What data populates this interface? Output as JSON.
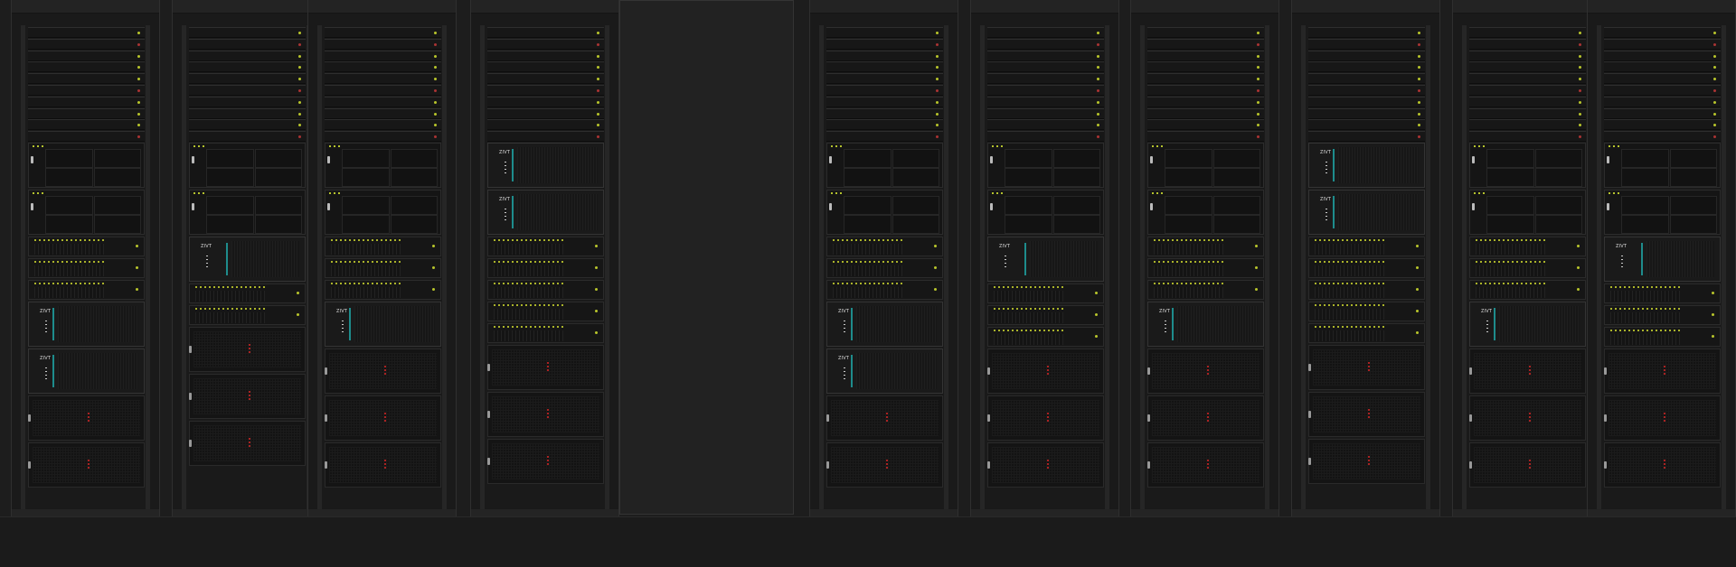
{
  "scene": {
    "colors": {
      "background": "#1d1d1d",
      "led_green": "#b8c52b",
      "led_red": "#aa2222",
      "brand_accent": "#1e8c8c"
    },
    "server_logo_text": "ZIVT",
    "racks": [
      {
        "name": "rack-1",
        "layout": [
          "1u-stack",
          "shelf",
          "shelf",
          "drives",
          "drives",
          "drives",
          "branded",
          "branded",
          "chassis",
          "chassis"
        ]
      },
      {
        "name": "rack-2",
        "layout": [
          "1u-stack",
          "shelf",
          "shelf",
          "branded-wide",
          "drives",
          "drives",
          "chassis",
          "chassis",
          "chassis"
        ]
      },
      {
        "name": "rack-3",
        "layout": [
          "1u-stack",
          "shelf",
          "shelf",
          "drives",
          "drives",
          "drives",
          "branded",
          "chassis",
          "chassis",
          "chassis"
        ]
      },
      {
        "name": "rack-4",
        "layout": [
          "1u-stack",
          "branded",
          "branded",
          "drives",
          "drives",
          "drives",
          "drives",
          "drives",
          "chassis",
          "chassis",
          "chassis"
        ]
      },
      {
        "name": "rack-5",
        "layout": [
          "1u-stack",
          "shelf",
          "shelf",
          "drives",
          "drives",
          "drives",
          "branded",
          "branded",
          "chassis",
          "chassis"
        ]
      },
      {
        "name": "rack-6",
        "layout": [
          "1u-stack",
          "shelf",
          "shelf",
          "branded-wide",
          "drives",
          "drives",
          "drives",
          "chassis",
          "chassis",
          "chassis"
        ]
      },
      {
        "name": "rack-7",
        "layout": [
          "1u-stack",
          "shelf",
          "shelf",
          "drives",
          "drives",
          "drives",
          "branded",
          "chassis",
          "chassis",
          "chassis"
        ]
      },
      {
        "name": "rack-8",
        "layout": [
          "1u-stack",
          "branded",
          "branded",
          "drives",
          "drives",
          "drives",
          "drives",
          "drives",
          "chassis",
          "chassis",
          "chassis"
        ]
      },
      {
        "name": "rack-9",
        "layout": [
          "1u-stack",
          "shelf",
          "shelf",
          "drives",
          "drives",
          "drives",
          "branded",
          "chassis",
          "chassis",
          "chassis"
        ]
      },
      {
        "name": "rack-10",
        "layout": [
          "1u-stack",
          "shelf",
          "shelf",
          "branded-wide",
          "drives",
          "drives",
          "drives",
          "chassis",
          "chassis",
          "chassis"
        ]
      }
    ]
  }
}
